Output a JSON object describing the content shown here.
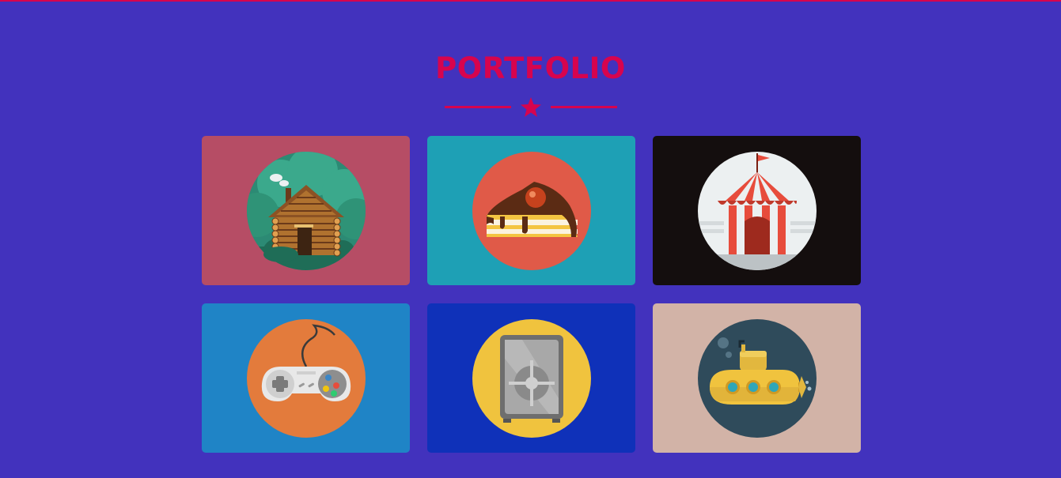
{
  "section": {
    "title": "PORTFOLIO",
    "divider_icon": "star-icon"
  },
  "colors": {
    "background": "#4232bd",
    "accent": "#d7044e"
  },
  "portfolio_items": [
    {
      "icon": "log-cabin-icon",
      "background": "#b64d65",
      "circle": "#2c8a74"
    },
    {
      "icon": "cake-slice-icon",
      "background": "#1ea0b5",
      "circle": "#e05a48"
    },
    {
      "icon": "circus-tent-icon",
      "background": "#140e0e",
      "circle": "#ecf0f1"
    },
    {
      "icon": "game-controller-icon",
      "background": "#1f84c6",
      "circle": "#e37b3c"
    },
    {
      "icon": "safe-icon",
      "background": "#0f31b9",
      "circle": "#f0c33e"
    },
    {
      "icon": "submarine-icon",
      "background": "#d2b3a7",
      "circle": "#2f4b5b"
    }
  ]
}
